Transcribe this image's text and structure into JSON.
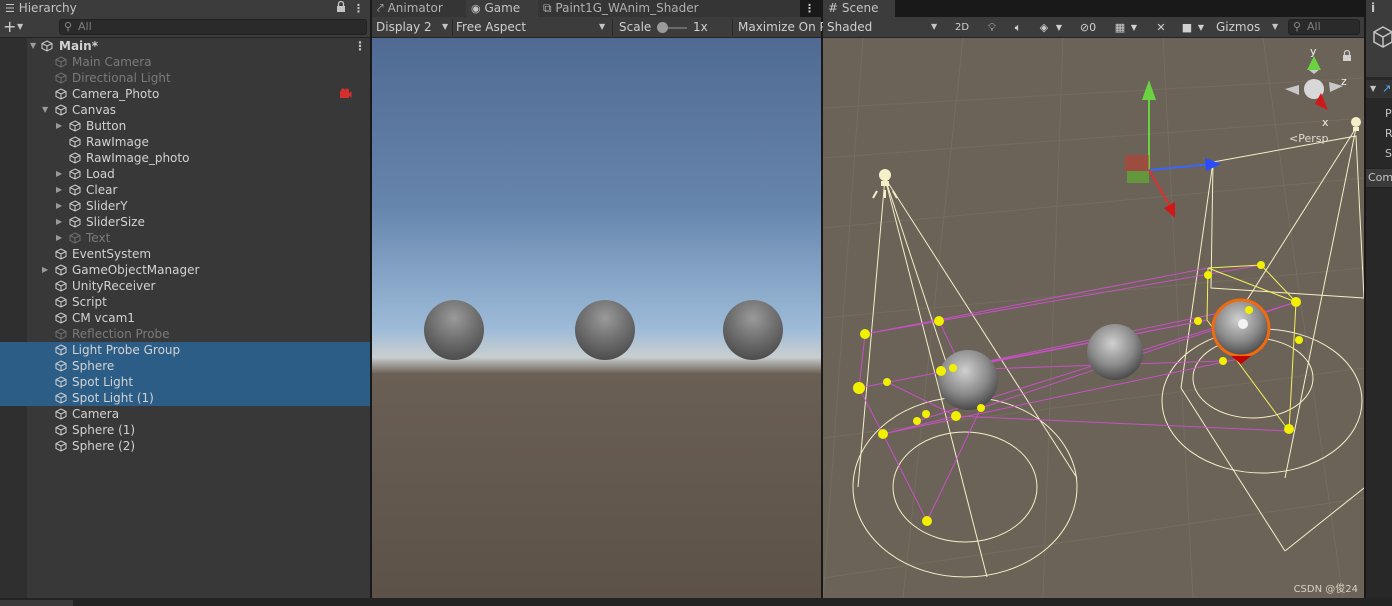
{
  "hierarchy": {
    "tab_label": "Hierarchy",
    "search_placeholder": "All",
    "scene_name": "Main*",
    "items": [
      {
        "label": "Main Camera",
        "dim": true
      },
      {
        "label": "Directional Light",
        "dim": true
      },
      {
        "label": "Camera_Photo",
        "dim": false
      },
      {
        "label": "Canvas",
        "dim": false
      },
      {
        "label": "Button",
        "dim": false
      },
      {
        "label": "RawImage",
        "dim": false
      },
      {
        "label": "RawImage_photo",
        "dim": false
      },
      {
        "label": "Load",
        "dim": false
      },
      {
        "label": "Clear",
        "dim": false
      },
      {
        "label": "SliderY",
        "dim": false
      },
      {
        "label": "SliderSize",
        "dim": false
      },
      {
        "label": "Text",
        "dim": true
      },
      {
        "label": "EventSystem",
        "dim": false
      },
      {
        "label": "GameObjectManager",
        "dim": false
      },
      {
        "label": "UnityReceiver",
        "dim": false
      },
      {
        "label": "Script",
        "dim": false
      },
      {
        "label": "CM vcam1",
        "dim": false
      },
      {
        "label": "Reflection Probe",
        "dim": true
      },
      {
        "label": "Light Probe Group",
        "dim": false
      },
      {
        "label": "Sphere",
        "dim": false
      },
      {
        "label": "Spot Light",
        "dim": false
      },
      {
        "label": "Spot Light (1)",
        "dim": false
      },
      {
        "label": "Camera",
        "dim": false
      },
      {
        "label": "Sphere (1)",
        "dim": false
      },
      {
        "label": "Sphere (2)",
        "dim": false
      }
    ]
  },
  "tabs": {
    "animator": "Animator",
    "game": "Game",
    "shader": "Paint1G_WAnim_Shader",
    "scene": "Scene"
  },
  "game_toolbar": {
    "display": "Display 2",
    "aspect": "Free Aspect",
    "scale_label": "Scale",
    "scale_value": "1x",
    "maximize": "Maximize On P"
  },
  "scene_toolbar": {
    "shading": "Shaded",
    "mode_2d": "2D",
    "hidden_count": "0",
    "gizmos": "Gizmos",
    "search_placeholder": "All"
  },
  "scene_overlay": {
    "persp_label": "<Persp",
    "axis_x": "x",
    "axis_y": "y",
    "axis_z": "z"
  },
  "inspector": {
    "info_glyph": "i",
    "labels": [
      "P",
      "R",
      "S"
    ],
    "component_label": "Com"
  },
  "watermark": "CSDN @俊24",
  "colors": {
    "selection": "#2c5d87",
    "light_probe": "#f0f000",
    "probe_lines": "#d64ed6",
    "gizmo_lines": "#f5efc9"
  }
}
